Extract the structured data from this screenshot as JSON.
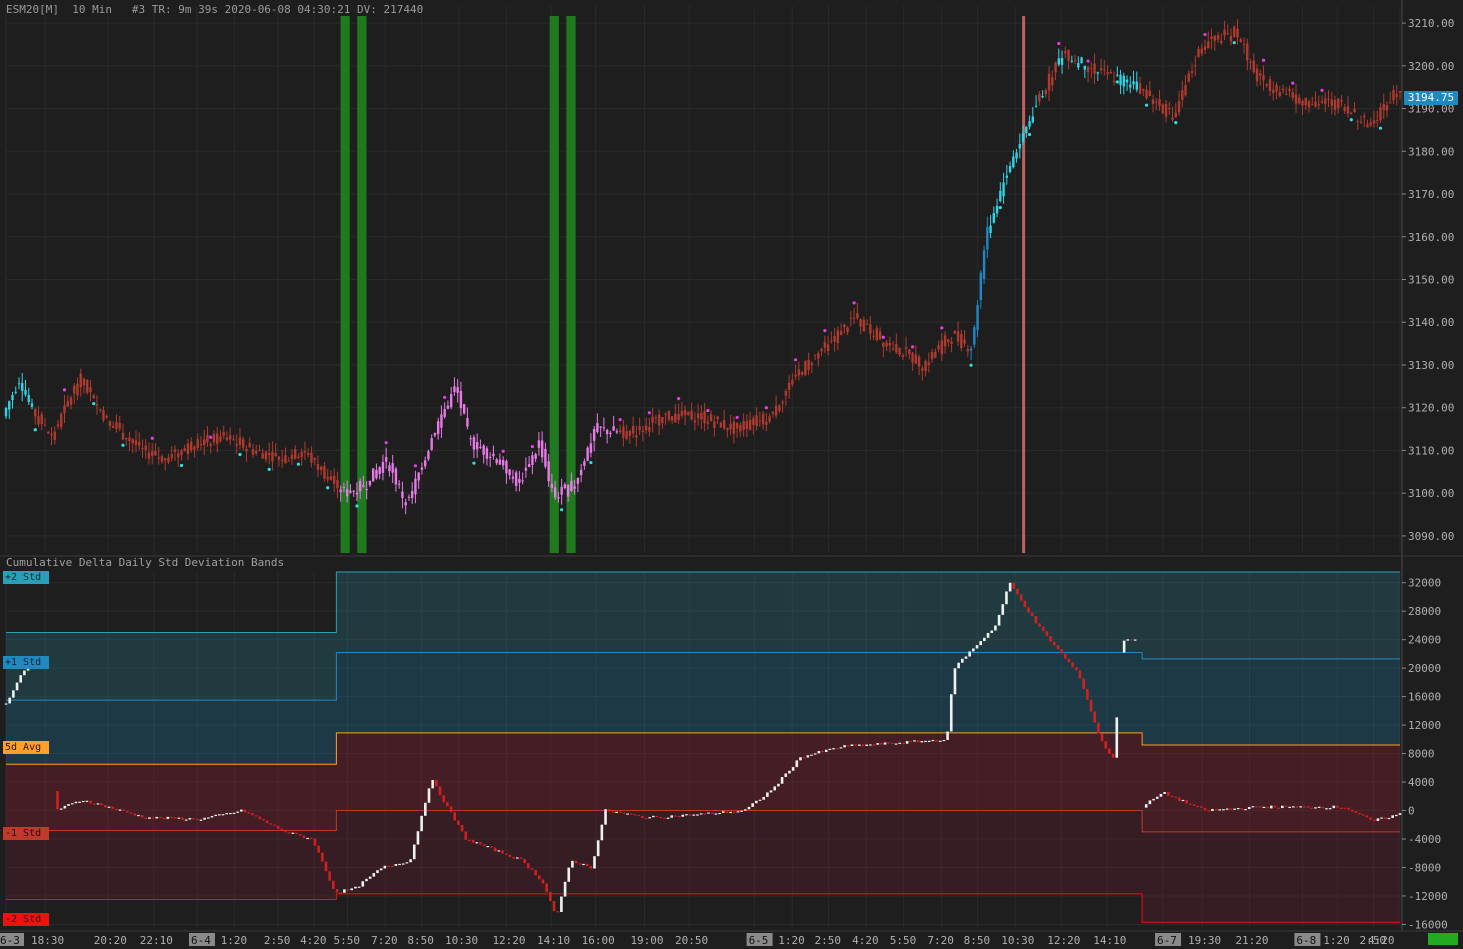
{
  "header": {
    "symbol": "ESM20[M]",
    "interval": "10 Min",
    "info": "#3 TR: 9m 39s 2020-06-08 04:30:21 DV: 217440"
  },
  "current_price": "3194.75",
  "indicator_title": "Cumulative Delta Daily Std Deviation Bands",
  "band_labels": {
    "plus2": "+2 Std",
    "plus1": "+1 Std",
    "avg": "5d Avg",
    "minus1": "-1 Std",
    "minus2": "-2 Std"
  },
  "colors": {
    "background": "#1e1e1e",
    "bear_candle": "#b03a2e",
    "bull_candle_highlight": "#e87ae8",
    "cyan_candle": "#2fd5e6",
    "blue_candle": "#1e88c8",
    "green_zone": "#1f7a1f",
    "vertical_marker": "#c06060",
    "band_plus2": "#2aa0b8",
    "band_plus1": "#1f8ac0",
    "band_avg": "#ff9f2a",
    "band_minus1": "#c0392b",
    "band_minus2": "#ee1111"
  },
  "chart_data": [
    {
      "type": "candlestick",
      "title": "ESM20[M] 10 Min",
      "y_ticks": [
        3090,
        3100,
        3110,
        3120,
        3130,
        3140,
        3150,
        3160,
        3170,
        3180,
        3190,
        3200,
        3210
      ],
      "y_tick_labels": [
        "3090.00",
        "3100.00",
        "3110.00",
        "3120.00",
        "3130.00",
        "3140.00",
        "3150.00",
        "3160.00",
        "3170.00",
        "3180.00",
        "3190.00",
        "3200.00",
        "3210.00"
      ],
      "ylim": [
        3086,
        3214
      ],
      "price_path": [
        [
          0,
          3118
        ],
        [
          0.012,
          3127
        ],
        [
          0.02,
          3120
        ],
        [
          0.035,
          3113
        ],
        [
          0.055,
          3127
        ],
        [
          0.075,
          3117
        ],
        [
          0.1,
          3110
        ],
        [
          0.115,
          3108
        ],
        [
          0.14,
          3112
        ],
        [
          0.16,
          3113
        ],
        [
          0.18,
          3110
        ],
        [
          0.2,
          3108
        ],
        [
          0.215,
          3110
        ],
        [
          0.23,
          3105
        ],
        [
          0.245,
          3100
        ],
        [
          0.26,
          3102
        ],
        [
          0.275,
          3108
        ],
        [
          0.29,
          3097
        ],
        [
          0.31,
          3115
        ],
        [
          0.325,
          3125
        ],
        [
          0.335,
          3112
        ],
        [
          0.355,
          3108
        ],
        [
          0.37,
          3102
        ],
        [
          0.385,
          3112
        ],
        [
          0.395,
          3099
        ],
        [
          0.41,
          3102
        ],
        [
          0.425,
          3115
        ],
        [
          0.45,
          3114
        ],
        [
          0.475,
          3118
        ],
        [
          0.5,
          3118
        ],
        [
          0.525,
          3115
        ],
        [
          0.55,
          3118
        ],
        [
          0.57,
          3128
        ],
        [
          0.59,
          3134
        ],
        [
          0.61,
          3141
        ],
        [
          0.63,
          3136
        ],
        [
          0.66,
          3130
        ],
        [
          0.68,
          3137
        ],
        [
          0.695,
          3134
        ],
        [
          0.705,
          3160
        ],
        [
          0.72,
          3175
        ],
        [
          0.74,
          3190
        ],
        [
          0.76,
          3203
        ],
        [
          0.79,
          3198
        ],
        [
          0.81,
          3196
        ],
        [
          0.84,
          3188
        ],
        [
          0.86,
          3205
        ],
        [
          0.885,
          3208
        ],
        [
          0.9,
          3197
        ],
        [
          0.93,
          3192
        ],
        [
          0.96,
          3191
        ],
        [
          0.98,
          3186
        ],
        [
          1.0,
          3194.75
        ]
      ],
      "green_zones": [
        [
          0.24,
          0.26
        ],
        [
          0.39,
          0.41
        ]
      ],
      "vertical_marker_at": 0.73
    },
    {
      "type": "bar",
      "title": "Cumulative Delta Daily Std Deviation Bands",
      "y_ticks": [
        32000,
        28000,
        24000,
        20000,
        16000,
        12000,
        8000,
        4000,
        0,
        -4000,
        -8000,
        -12000,
        -16000
      ],
      "y_tick_labels": [
        "32000",
        "28000",
        "24000",
        "20000",
        "16000",
        "12000",
        "8000",
        "4000",
        "0",
        "-4000",
        "-8000",
        "-12000",
        "-16000"
      ],
      "ylim": [
        -16500,
        33500
      ],
      "bands": {
        "segments": [
          0,
          0.237,
          0.815,
          1.0
        ],
        "plus2": [
          25000,
          33500,
          33500
        ],
        "plus1": [
          15500,
          22200,
          21300
        ],
        "avg": [
          6500,
          10900,
          9200
        ],
        "minus1": [
          -2800,
          0,
          -3000
        ],
        "minus2": [
          -12500,
          -11700,
          -15700
        ]
      },
      "delta_path": [
        [
          0,
          15000
        ],
        [
          0.015,
          20500
        ],
        [
          0.03,
          20000
        ],
        [
          0.035,
          0
        ],
        [
          0.055,
          1500
        ],
        [
          0.1,
          -1000
        ],
        [
          0.14,
          -1200
        ],
        [
          0.17,
          0
        ],
        [
          0.2,
          -3000
        ],
        [
          0.22,
          -4000
        ],
        [
          0.236,
          -11500
        ],
        [
          0.25,
          -11000
        ],
        [
          0.27,
          -8000
        ],
        [
          0.29,
          -7000
        ],
        [
          0.305,
          4500
        ],
        [
          0.315,
          1000
        ],
        [
          0.33,
          -4000
        ],
        [
          0.35,
          -5500
        ],
        [
          0.37,
          -7000
        ],
        [
          0.385,
          -10000
        ],
        [
          0.395,
          -15000
        ],
        [
          0.405,
          -7000
        ],
        [
          0.42,
          -8000
        ],
        [
          0.43,
          0
        ],
        [
          0.46,
          -1000
        ],
        [
          0.5,
          -500
        ],
        [
          0.53,
          0
        ],
        [
          0.55,
          3000
        ],
        [
          0.57,
          7500
        ],
        [
          0.6,
          9000
        ],
        [
          0.64,
          9500
        ],
        [
          0.675,
          10000
        ],
        [
          0.68,
          20000
        ],
        [
          0.7,
          24000
        ],
        [
          0.71,
          26000
        ],
        [
          0.72,
          32000
        ],
        [
          0.74,
          26000
        ],
        [
          0.77,
          19000
        ],
        [
          0.785,
          10000
        ],
        [
          0.795,
          7000
        ],
        [
          0.8,
          24000
        ],
        [
          0.81,
          24000
        ],
        [
          0.815,
          500
        ],
        [
          0.83,
          2500
        ],
        [
          0.86,
          0
        ],
        [
          0.9,
          500
        ],
        [
          0.96,
          500
        ],
        [
          0.98,
          -1500
        ],
        [
          1.0,
          -500
        ]
      ]
    }
  ],
  "x_axis": {
    "labels": [
      {
        "text": "6-3",
        "t": 0.0,
        "day": true
      },
      {
        "text": "18:30",
        "t": 0.028
      },
      {
        "text": "20:20",
        "t": 0.073
      },
      {
        "text": "22:10",
        "t": 0.106
      },
      {
        "text": "6-4",
        "t": 0.137,
        "day": true
      },
      {
        "text": "1:20",
        "t": 0.164
      },
      {
        "text": "2:50",
        "t": 0.195
      },
      {
        "text": "4:20",
        "t": 0.221
      },
      {
        "text": "5:50",
        "t": 0.245
      },
      {
        "text": "7:20",
        "t": 0.272
      },
      {
        "text": "8:50",
        "t": 0.298
      },
      {
        "text": "10:30",
        "t": 0.325
      },
      {
        "text": "12:20",
        "t": 0.359
      },
      {
        "text": "14:10",
        "t": 0.391
      },
      {
        "text": "16:00",
        "t": 0.423
      },
      {
        "text": "19:00",
        "t": 0.458
      },
      {
        "text": "20:50",
        "t": 0.49
      },
      {
        "text": "6-5",
        "t": 0.537,
        "day": true
      },
      {
        "text": "1:20",
        "t": 0.564
      },
      {
        "text": "2:50",
        "t": 0.59
      },
      {
        "text": "4:20",
        "t": 0.617
      },
      {
        "text": "5:50",
        "t": 0.644
      },
      {
        "text": "7:20",
        "t": 0.671
      },
      {
        "text": "8:50",
        "t": 0.697
      },
      {
        "text": "10:30",
        "t": 0.724
      },
      {
        "text": "12:20",
        "t": 0.757
      },
      {
        "text": "14:10",
        "t": 0.79
      },
      {
        "text": "6-7",
        "t": 0.83,
        "day": true
      },
      {
        "text": "19:30",
        "t": 0.858
      },
      {
        "text": "21:20",
        "t": 0.892
      },
      {
        "text": "6-8",
        "t": 0.93,
        "day": true
      },
      {
        "text": "1:20",
        "t": 0.955
      },
      {
        "text": "2:50",
        "t": 0.981
      },
      {
        "text": "4:20",
        "t": 1.0
      }
    ]
  }
}
